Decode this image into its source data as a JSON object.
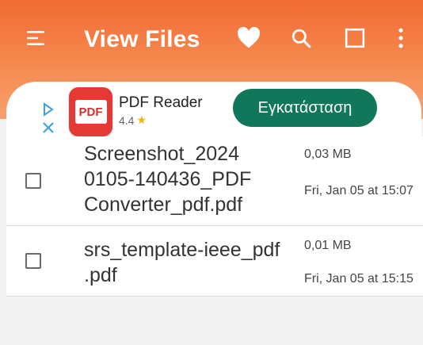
{
  "header": {
    "title": "View Files",
    "icons": [
      "menu-icon",
      "heart-icon",
      "search-icon",
      "select-all-icon",
      "more-vert-icon"
    ],
    "gradient": [
      "#f26a33",
      "#f6a070"
    ]
  },
  "ad": {
    "app_name": "PDF Reader",
    "logo_text": "PDF",
    "rating": "4.4",
    "install_label": "Εγκατάσταση",
    "install_color": "#11775a"
  },
  "files": [
    {
      "name_lines": [
        "Screenshot_2024",
        "0105-140436_PDF",
        "Converter_pdf.pdf"
      ],
      "size": "0,03 MB",
      "date": "Fri, Jan 05 at 15:07"
    },
    {
      "name_lines": [
        "srs_template-ieee_pdf",
        ".pdf"
      ],
      "size": "0,01 MB",
      "date": "Fri, Jan 05 at 15:15"
    }
  ]
}
